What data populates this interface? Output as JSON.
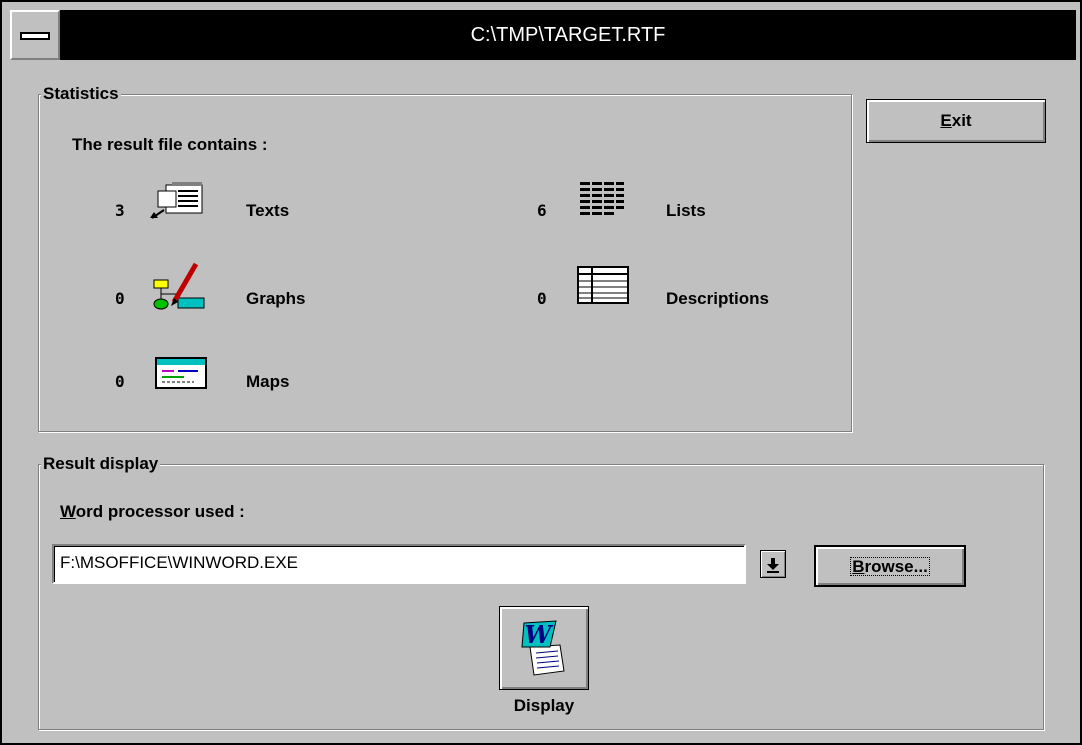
{
  "window": {
    "title": "C:\\TMP\\TARGET.RTF"
  },
  "statistics": {
    "legend": "Statistics",
    "intro": "The result file contains :",
    "items": [
      {
        "count": "3",
        "label": "Texts",
        "icon": "texts-icon"
      },
      {
        "count": "6",
        "label": "Lists",
        "icon": "lists-icon"
      },
      {
        "count": "0",
        "label": "Graphs",
        "icon": "graphs-icon"
      },
      {
        "count": "0",
        "label": "Descriptions",
        "icon": "descriptions-icon"
      },
      {
        "count": "0",
        "label": "Maps",
        "icon": "maps-icon"
      }
    ]
  },
  "exit_button": {
    "accel": "E",
    "rest": "xit"
  },
  "result_display": {
    "legend": "Result display",
    "processor_label_accel": "W",
    "processor_label_rest": "ord processor used :",
    "processor_path": "F:\\MSOFFICE\\WINWORD.EXE",
    "browse_accel": "B",
    "browse_rest": "rowse...",
    "display_label": "Display"
  },
  "colors": {
    "face": "#c0c0c0",
    "shadow": "#808080",
    "highlight": "#ffffff",
    "titlebar": "#000000"
  }
}
